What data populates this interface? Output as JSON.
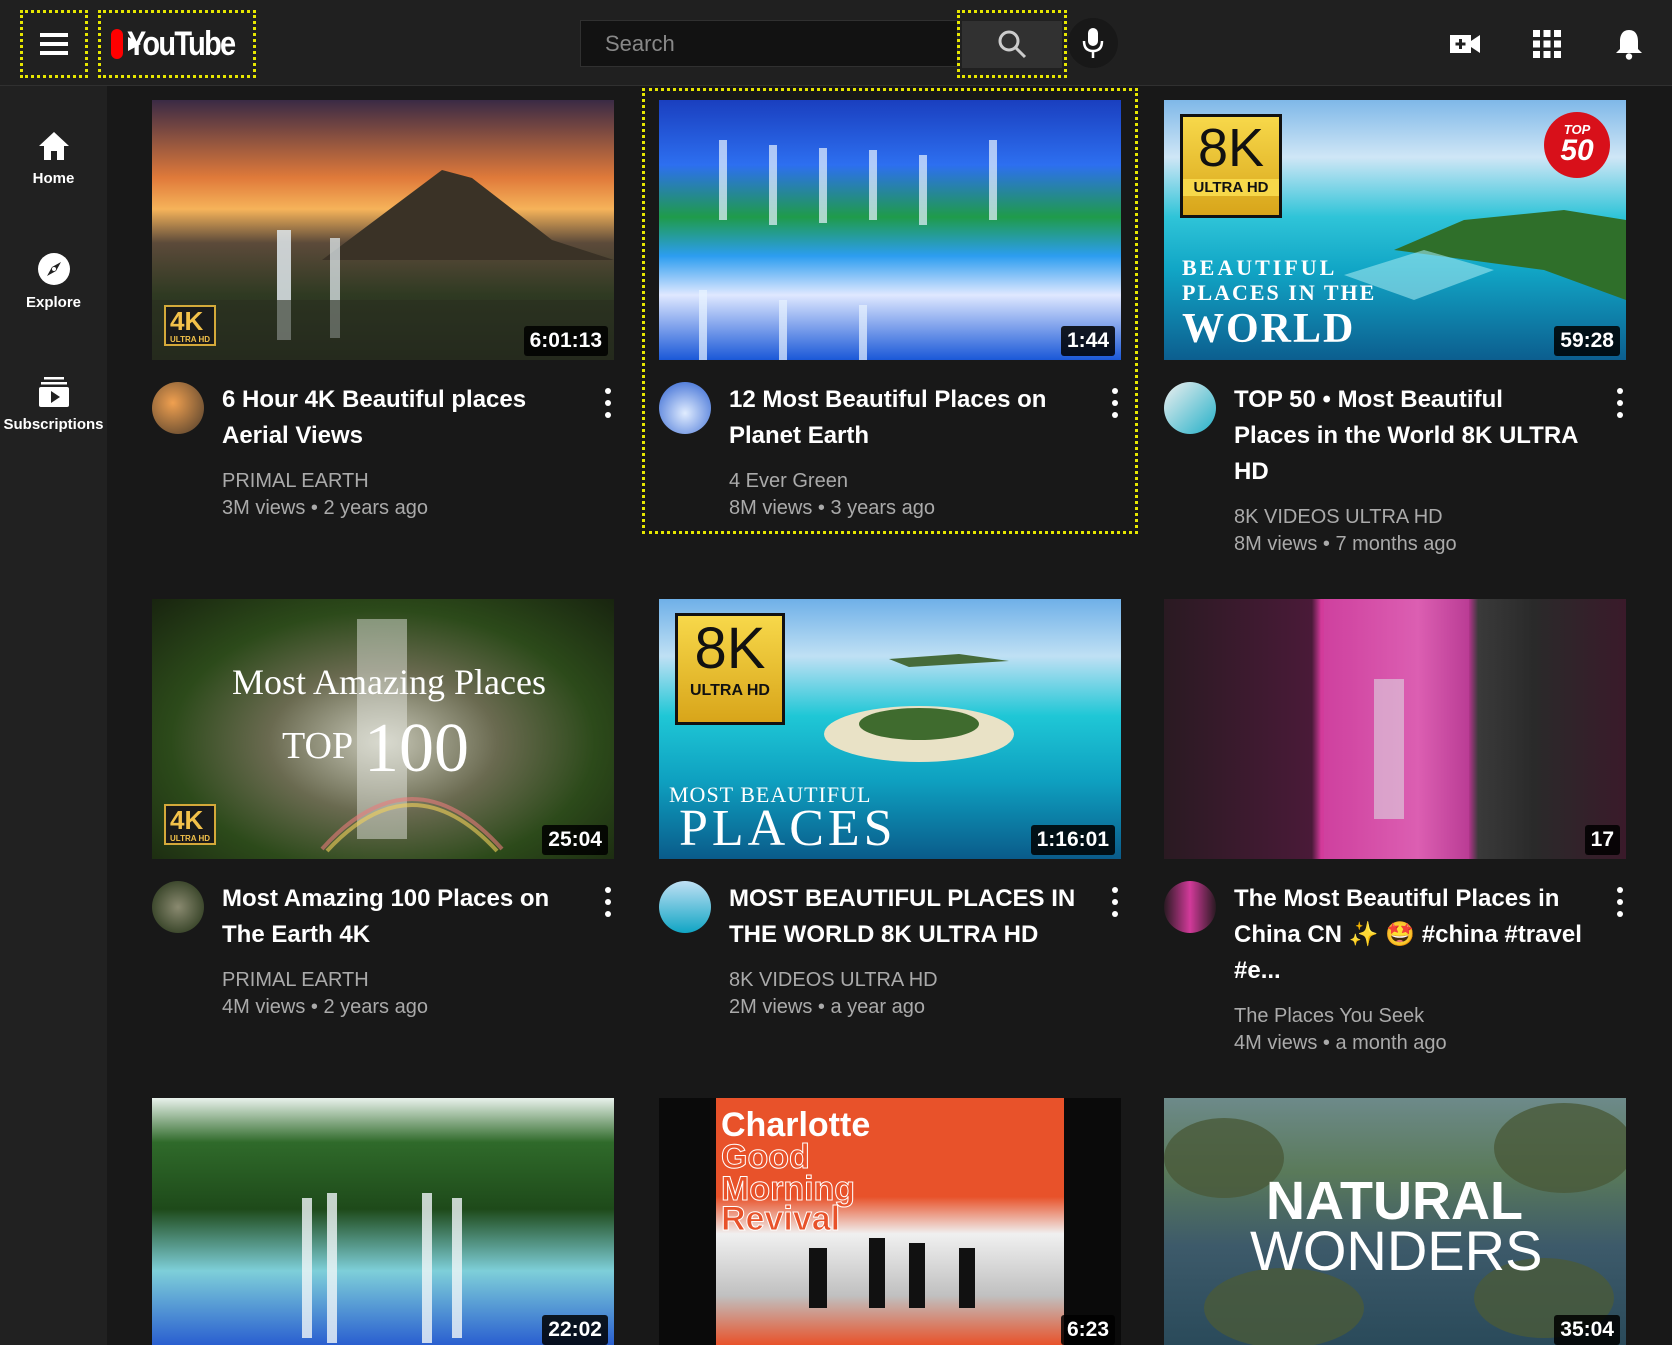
{
  "header": {
    "brand": "YouTube",
    "search_placeholder": "Search"
  },
  "sidebar": {
    "items": [
      {
        "label": "Home"
      },
      {
        "label": "Explore"
      },
      {
        "label": "Subscriptions"
      }
    ]
  },
  "videos": [
    {
      "title": "6 Hour 4K Beautiful places Aerial Views",
      "channel": "PRIMAL EARTH",
      "views": "3M views • 2 years ago",
      "duration": "6:01:13",
      "badge": "4K",
      "badge_sub": "ULTRA HD"
    },
    {
      "title": "12 Most Beautiful Places on Planet Earth",
      "channel": "4 Ever Green",
      "views": "8M views • 3 years ago",
      "duration": "1:44"
    },
    {
      "title": "TOP 50 • Most Beautiful Places in the World 8K ULTRA HD",
      "channel": "8K VIDEOS ULTRA HD",
      "views": "8M views • 7 months ago",
      "duration": "59:28",
      "thumb_text": {
        "res": "8K",
        "res_sub": "ULTRA HD",
        "top": "TOP",
        "top_num": "50",
        "line1": "BEAUTIFUL",
        "line2": "PLACES IN THE",
        "line3": "WORLD"
      }
    },
    {
      "title": "Most Amazing 100 Places on The Earth 4K",
      "channel": "PRIMAL EARTH",
      "views": "4M views • 2 years ago",
      "duration": "25:04",
      "thumb_text": {
        "line1": "Most Amazing Places",
        "top": "TOP",
        "num": "100",
        "badge": "4K",
        "badge_sub": "ULTRA HD"
      }
    },
    {
      "title": "MOST BEAUTIFUL PLACES IN THE WORLD 8K ULTRA HD",
      "channel": "8K VIDEOS ULTRA HD",
      "views": "2M views • a year ago",
      "duration": "1:16:01",
      "thumb_text": {
        "res": "8K",
        "res_sub": "ULTRA HD",
        "line1": "MOST BEAUTIFUL",
        "line2": "PLACES"
      }
    },
    {
      "title": "The Most Beautiful Places in China CN ✨ 🤩 #china #travel #e...",
      "channel": "The Places You Seek",
      "views": "4M views • a month ago",
      "duration": "17"
    },
    {
      "duration": "22:02"
    },
    {
      "duration": "6:23",
      "thumb_text": {
        "line1": "Charlotte",
        "line2": "Good",
        "line3": "Morning",
        "line4": "Revival"
      }
    },
    {
      "duration": "35:04",
      "thumb_text": {
        "line1": "NATURAL",
        "line2": "WONDERS"
      }
    }
  ],
  "colors": {
    "background": "#181818",
    "topbar": "#202020",
    "sidebar": "#212121",
    "highlight": "#e6e600",
    "brand_red": "#ff0000",
    "secondary_text": "#aaaaaa"
  }
}
